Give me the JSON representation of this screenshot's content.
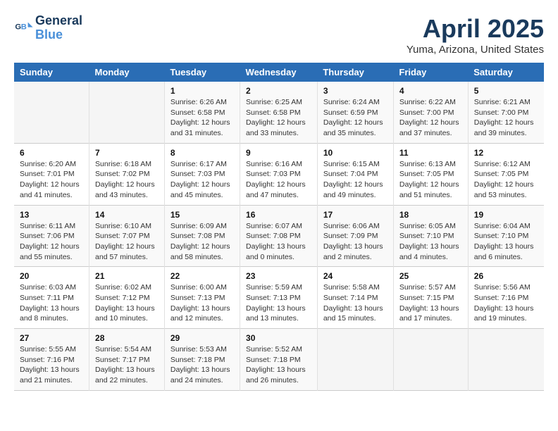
{
  "logo": {
    "line1": "General",
    "line2": "Blue"
  },
  "title": "April 2025",
  "subtitle": "Yuma, Arizona, United States",
  "weekdays": [
    "Sunday",
    "Monday",
    "Tuesday",
    "Wednesday",
    "Thursday",
    "Friday",
    "Saturday"
  ],
  "weeks": [
    [
      {
        "day": "",
        "sunrise": "",
        "sunset": "",
        "daylight": ""
      },
      {
        "day": "",
        "sunrise": "",
        "sunset": "",
        "daylight": ""
      },
      {
        "day": "1",
        "sunrise": "Sunrise: 6:26 AM",
        "sunset": "Sunset: 6:58 PM",
        "daylight": "Daylight: 12 hours and 31 minutes."
      },
      {
        "day": "2",
        "sunrise": "Sunrise: 6:25 AM",
        "sunset": "Sunset: 6:58 PM",
        "daylight": "Daylight: 12 hours and 33 minutes."
      },
      {
        "day": "3",
        "sunrise": "Sunrise: 6:24 AM",
        "sunset": "Sunset: 6:59 PM",
        "daylight": "Daylight: 12 hours and 35 minutes."
      },
      {
        "day": "4",
        "sunrise": "Sunrise: 6:22 AM",
        "sunset": "Sunset: 7:00 PM",
        "daylight": "Daylight: 12 hours and 37 minutes."
      },
      {
        "day": "5",
        "sunrise": "Sunrise: 6:21 AM",
        "sunset": "Sunset: 7:00 PM",
        "daylight": "Daylight: 12 hours and 39 minutes."
      }
    ],
    [
      {
        "day": "6",
        "sunrise": "Sunrise: 6:20 AM",
        "sunset": "Sunset: 7:01 PM",
        "daylight": "Daylight: 12 hours and 41 minutes."
      },
      {
        "day": "7",
        "sunrise": "Sunrise: 6:18 AM",
        "sunset": "Sunset: 7:02 PM",
        "daylight": "Daylight: 12 hours and 43 minutes."
      },
      {
        "day": "8",
        "sunrise": "Sunrise: 6:17 AM",
        "sunset": "Sunset: 7:03 PM",
        "daylight": "Daylight: 12 hours and 45 minutes."
      },
      {
        "day": "9",
        "sunrise": "Sunrise: 6:16 AM",
        "sunset": "Sunset: 7:03 PM",
        "daylight": "Daylight: 12 hours and 47 minutes."
      },
      {
        "day": "10",
        "sunrise": "Sunrise: 6:15 AM",
        "sunset": "Sunset: 7:04 PM",
        "daylight": "Daylight: 12 hours and 49 minutes."
      },
      {
        "day": "11",
        "sunrise": "Sunrise: 6:13 AM",
        "sunset": "Sunset: 7:05 PM",
        "daylight": "Daylight: 12 hours and 51 minutes."
      },
      {
        "day": "12",
        "sunrise": "Sunrise: 6:12 AM",
        "sunset": "Sunset: 7:05 PM",
        "daylight": "Daylight: 12 hours and 53 minutes."
      }
    ],
    [
      {
        "day": "13",
        "sunrise": "Sunrise: 6:11 AM",
        "sunset": "Sunset: 7:06 PM",
        "daylight": "Daylight: 12 hours and 55 minutes."
      },
      {
        "day": "14",
        "sunrise": "Sunrise: 6:10 AM",
        "sunset": "Sunset: 7:07 PM",
        "daylight": "Daylight: 12 hours and 57 minutes."
      },
      {
        "day": "15",
        "sunrise": "Sunrise: 6:09 AM",
        "sunset": "Sunset: 7:08 PM",
        "daylight": "Daylight: 12 hours and 58 minutes."
      },
      {
        "day": "16",
        "sunrise": "Sunrise: 6:07 AM",
        "sunset": "Sunset: 7:08 PM",
        "daylight": "Daylight: 13 hours and 0 minutes."
      },
      {
        "day": "17",
        "sunrise": "Sunrise: 6:06 AM",
        "sunset": "Sunset: 7:09 PM",
        "daylight": "Daylight: 13 hours and 2 minutes."
      },
      {
        "day": "18",
        "sunrise": "Sunrise: 6:05 AM",
        "sunset": "Sunset: 7:10 PM",
        "daylight": "Daylight: 13 hours and 4 minutes."
      },
      {
        "day": "19",
        "sunrise": "Sunrise: 6:04 AM",
        "sunset": "Sunset: 7:10 PM",
        "daylight": "Daylight: 13 hours and 6 minutes."
      }
    ],
    [
      {
        "day": "20",
        "sunrise": "Sunrise: 6:03 AM",
        "sunset": "Sunset: 7:11 PM",
        "daylight": "Daylight: 13 hours and 8 minutes."
      },
      {
        "day": "21",
        "sunrise": "Sunrise: 6:02 AM",
        "sunset": "Sunset: 7:12 PM",
        "daylight": "Daylight: 13 hours and 10 minutes."
      },
      {
        "day": "22",
        "sunrise": "Sunrise: 6:00 AM",
        "sunset": "Sunset: 7:13 PM",
        "daylight": "Daylight: 13 hours and 12 minutes."
      },
      {
        "day": "23",
        "sunrise": "Sunrise: 5:59 AM",
        "sunset": "Sunset: 7:13 PM",
        "daylight": "Daylight: 13 hours and 13 minutes."
      },
      {
        "day": "24",
        "sunrise": "Sunrise: 5:58 AM",
        "sunset": "Sunset: 7:14 PM",
        "daylight": "Daylight: 13 hours and 15 minutes."
      },
      {
        "day": "25",
        "sunrise": "Sunrise: 5:57 AM",
        "sunset": "Sunset: 7:15 PM",
        "daylight": "Daylight: 13 hours and 17 minutes."
      },
      {
        "day": "26",
        "sunrise": "Sunrise: 5:56 AM",
        "sunset": "Sunset: 7:16 PM",
        "daylight": "Daylight: 13 hours and 19 minutes."
      }
    ],
    [
      {
        "day": "27",
        "sunrise": "Sunrise: 5:55 AM",
        "sunset": "Sunset: 7:16 PM",
        "daylight": "Daylight: 13 hours and 21 minutes."
      },
      {
        "day": "28",
        "sunrise": "Sunrise: 5:54 AM",
        "sunset": "Sunset: 7:17 PM",
        "daylight": "Daylight: 13 hours and 22 minutes."
      },
      {
        "day": "29",
        "sunrise": "Sunrise: 5:53 AM",
        "sunset": "Sunset: 7:18 PM",
        "daylight": "Daylight: 13 hours and 24 minutes."
      },
      {
        "day": "30",
        "sunrise": "Sunrise: 5:52 AM",
        "sunset": "Sunset: 7:18 PM",
        "daylight": "Daylight: 13 hours and 26 minutes."
      },
      {
        "day": "",
        "sunrise": "",
        "sunset": "",
        "daylight": ""
      },
      {
        "day": "",
        "sunrise": "",
        "sunset": "",
        "daylight": ""
      },
      {
        "day": "",
        "sunrise": "",
        "sunset": "",
        "daylight": ""
      }
    ]
  ]
}
